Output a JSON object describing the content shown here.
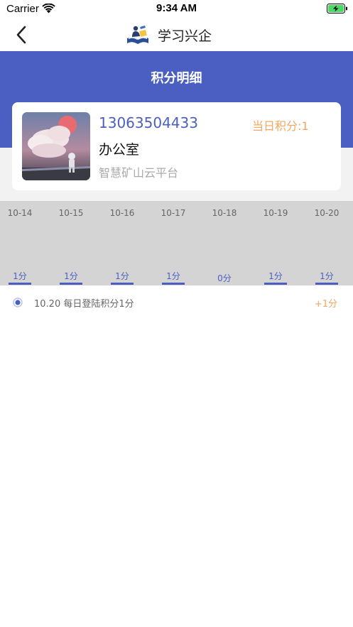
{
  "status_bar": {
    "carrier": "Carrier",
    "time": "9:34 AM"
  },
  "nav": {
    "title": "学习兴企",
    "back_icon": "chevron-left-icon",
    "logo_icon": "book-reader-logo-icon"
  },
  "header": {
    "title": "积分明细"
  },
  "profile": {
    "phone": "13063504433",
    "daily_points": "当日积分:1",
    "org": "办公室",
    "platform": "智慧矿山云平台"
  },
  "week": [
    {
      "date": "10-14",
      "points": "1分",
      "has_bar": true
    },
    {
      "date": "10-15",
      "points": "1分",
      "has_bar": true
    },
    {
      "date": "10-16",
      "points": "1分",
      "has_bar": true
    },
    {
      "date": "10-17",
      "points": "1分",
      "has_bar": true
    },
    {
      "date": "10-18",
      "points": "0分",
      "has_bar": false
    },
    {
      "date": "10-19",
      "points": "1分",
      "has_bar": true
    },
    {
      "date": "10-20",
      "points": "1分",
      "has_bar": true
    }
  ],
  "records": [
    {
      "text": "10.20 每日登陆积分1分",
      "points": "+1分"
    }
  ],
  "colors": {
    "accent": "#4a5fc1",
    "orange": "#f5a660",
    "strip_bg": "#d4d4d4"
  }
}
